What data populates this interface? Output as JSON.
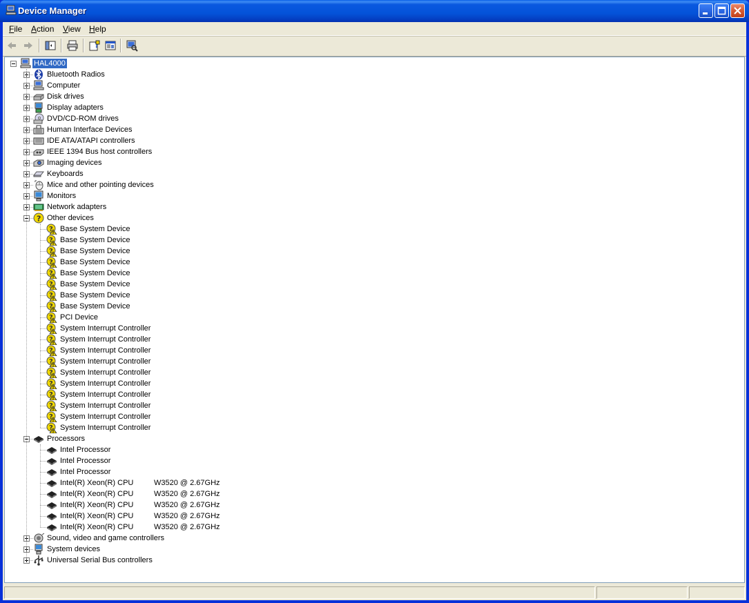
{
  "window": {
    "title": "Device Manager"
  },
  "menu": [
    {
      "label": "File",
      "u": "F",
      "rest": "ile"
    },
    {
      "label": "Action",
      "u": "A",
      "rest": "ction"
    },
    {
      "label": "View",
      "u": "V",
      "rest": "iew"
    },
    {
      "label": "Help",
      "u": "H",
      "rest": "elp"
    }
  ],
  "toolbar": [
    "back-icon",
    "forward-icon",
    "show-hide-tree-icon",
    "print-icon",
    "help-icon",
    "properties-icon",
    "scan-hardware-icon"
  ],
  "tree": {
    "root": "HAL4000",
    "categories": [
      {
        "label": "Bluetooth Radios",
        "icon": "bluetooth-icon",
        "expanded": false
      },
      {
        "label": "Computer",
        "icon": "computer-icon",
        "expanded": false
      },
      {
        "label": "Disk drives",
        "icon": "disk-drive-icon",
        "expanded": false
      },
      {
        "label": "Display adapters",
        "icon": "display-adapter-icon",
        "expanded": false
      },
      {
        "label": "DVD/CD-ROM drives",
        "icon": "dvd-drive-icon",
        "expanded": false
      },
      {
        "label": "Human Interface Devices",
        "icon": "hid-icon",
        "expanded": false
      },
      {
        "label": "IDE ATA/ATAPI controllers",
        "icon": "ide-controller-icon",
        "expanded": false
      },
      {
        "label": "IEEE 1394 Bus host controllers",
        "icon": "ieee1394-icon",
        "expanded": false
      },
      {
        "label": "Imaging devices",
        "icon": "imaging-device-icon",
        "expanded": false
      },
      {
        "label": "Keyboards",
        "icon": "keyboard-icon",
        "expanded": false
      },
      {
        "label": "Mice and other pointing devices",
        "icon": "mouse-icon",
        "expanded": false
      },
      {
        "label": "Monitors",
        "icon": "monitor-icon",
        "expanded": false
      },
      {
        "label": "Network adapters",
        "icon": "network-adapter-icon",
        "expanded": false
      },
      {
        "label": "Other devices",
        "icon": "unknown-device-icon",
        "expanded": true,
        "children": [
          {
            "label": "Base System Device",
            "icon": "warning-device-icon"
          },
          {
            "label": "Base System Device",
            "icon": "warning-device-icon"
          },
          {
            "label": "Base System Device",
            "icon": "warning-device-icon"
          },
          {
            "label": "Base System Device",
            "icon": "warning-device-icon"
          },
          {
            "label": "Base System Device",
            "icon": "warning-device-icon"
          },
          {
            "label": "Base System Device",
            "icon": "warning-device-icon"
          },
          {
            "label": "Base System Device",
            "icon": "warning-device-icon"
          },
          {
            "label": "Base System Device",
            "icon": "warning-device-icon"
          },
          {
            "label": "PCI Device",
            "icon": "warning-device-icon"
          },
          {
            "label": "System Interrupt Controller",
            "icon": "warning-device-icon"
          },
          {
            "label": "System Interrupt Controller",
            "icon": "warning-device-icon"
          },
          {
            "label": "System Interrupt Controller",
            "icon": "warning-device-icon"
          },
          {
            "label": "System Interrupt Controller",
            "icon": "warning-device-icon"
          },
          {
            "label": "System Interrupt Controller",
            "icon": "warning-device-icon"
          },
          {
            "label": "System Interrupt Controller",
            "icon": "warning-device-icon"
          },
          {
            "label": "System Interrupt Controller",
            "icon": "warning-device-icon"
          },
          {
            "label": "System Interrupt Controller",
            "icon": "warning-device-icon"
          },
          {
            "label": "System Interrupt Controller",
            "icon": "warning-device-icon"
          },
          {
            "label": "System Interrupt Controller",
            "icon": "warning-device-icon"
          }
        ]
      },
      {
        "label": "Processors",
        "icon": "processor-icon",
        "expanded": true,
        "children": [
          {
            "label": "Intel Processor",
            "icon": "processor-icon"
          },
          {
            "label": "Intel Processor",
            "icon": "processor-icon"
          },
          {
            "label": "Intel Processor",
            "icon": "processor-icon"
          },
          {
            "label": "Intel(R) Xeon(R) CPU",
            "suffix": "W3520  @ 2.67GHz",
            "icon": "processor-icon"
          },
          {
            "label": "Intel(R) Xeon(R) CPU",
            "suffix": "W3520  @ 2.67GHz",
            "icon": "processor-icon"
          },
          {
            "label": "Intel(R) Xeon(R) CPU",
            "suffix": "W3520  @ 2.67GHz",
            "icon": "processor-icon"
          },
          {
            "label": "Intel(R) Xeon(R) CPU",
            "suffix": "W3520  @ 2.67GHz",
            "icon": "processor-icon"
          },
          {
            "label": "Intel(R) Xeon(R) CPU",
            "suffix": "W3520  @ 2.67GHz",
            "icon": "processor-icon"
          }
        ]
      },
      {
        "label": "Sound, video and game controllers",
        "icon": "sound-icon",
        "expanded": false
      },
      {
        "label": "System devices",
        "icon": "system-devices-icon",
        "expanded": false
      },
      {
        "label": "Universal Serial Bus controllers",
        "icon": "usb-icon",
        "expanded": false
      }
    ]
  }
}
